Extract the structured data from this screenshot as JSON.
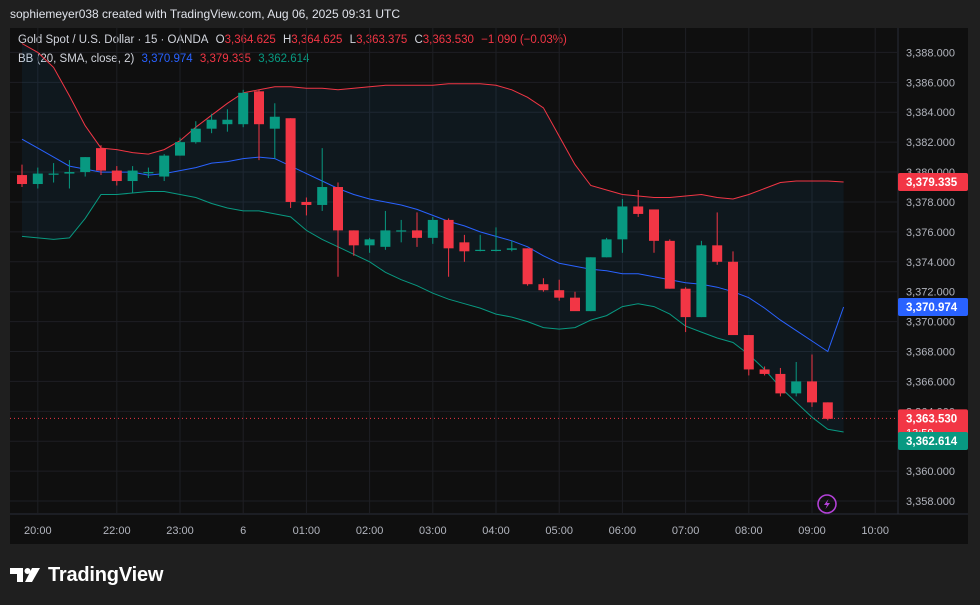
{
  "watermark": {
    "text": "sophiemeyer038 created with TradingView.com, Aug 06, 2025 09:31 UTC"
  },
  "legend": {
    "symbol": "Gold Spot / U.S. Dollar · 15 · OANDA",
    "o_label": "O",
    "o_value": "3,364.625",
    "h_label": "H",
    "h_value": "3,364.625",
    "l_label": "L",
    "l_value": "3,363.375",
    "c_label": "C",
    "c_value": "3,363.530",
    "change": "−1.090 (−0.03%)",
    "bb_label": "BB (20, SMA, close, 2)",
    "bb_basis": "3,370.974",
    "bb_upper": "3,379.335",
    "bb_lower": "3,362.614"
  },
  "price_tags": {
    "upper": "3,379.335",
    "basis": "3,370.974",
    "last_price": "3,363.530",
    "countdown": "13:59",
    "lower": "3,362.614"
  },
  "footer": {
    "brand": "TradingView"
  },
  "colors": {
    "up": "#089981",
    "down": "#f23645",
    "basis": "#2962ff",
    "upper_band": "#f23645",
    "lower_band": "#089981"
  },
  "chart_data": {
    "type": "candlestick",
    "y_range": [
      3357,
      3389.5
    ],
    "y_ticks": [
      "3,358.000",
      "3,360.000",
      "3,362.000",
      "3,364.000",
      "3,366.000",
      "3,368.000",
      "3,370.000",
      "3,372.000",
      "3,374.000",
      "3,376.000",
      "3,378.000",
      "3,380.000",
      "3,382.000",
      "3,384.000",
      "3,386.000",
      "3,388.000"
    ],
    "y_tick_values": [
      3358,
      3360,
      3362,
      3364,
      3366,
      3368,
      3370,
      3372,
      3374,
      3376,
      3378,
      3380,
      3382,
      3384,
      3386,
      3388
    ],
    "x_labels": [
      "20:00",
      "22:00",
      "23:00",
      "6",
      "01:00",
      "02:00",
      "03:00",
      "04:00",
      "05:00",
      "06:00",
      "07:00",
      "08:00",
      "09:00",
      "10:00"
    ],
    "x_label_index": [
      1,
      6,
      10,
      14,
      18,
      22,
      26,
      30,
      34,
      38,
      42,
      46,
      50,
      54
    ],
    "candles": [
      {
        "o": 3379.8,
        "h": 3380.5,
        "l": 3379.0,
        "c": 3379.2
      },
      {
        "o": 3379.2,
        "h": 3380.3,
        "l": 3378.9,
        "c": 3379.9
      },
      {
        "o": 3379.9,
        "h": 3380.6,
        "l": 3379.3,
        "c": 3379.9
      },
      {
        "o": 3379.9,
        "h": 3380.8,
        "l": 3378.9,
        "c": 3380.0
      },
      {
        "o": 3380.0,
        "h": 3381.0,
        "l": 3379.7,
        "c": 3381.0
      },
      {
        "o": 3381.6,
        "h": 3381.8,
        "l": 3379.8,
        "c": 3380.1
      },
      {
        "o": 3380.1,
        "h": 3380.4,
        "l": 3379.1,
        "c": 3379.4
      },
      {
        "o": 3379.4,
        "h": 3380.4,
        "l": 3378.6,
        "c": 3380.1
      },
      {
        "o": 3380.0,
        "h": 3380.3,
        "l": 3379.6,
        "c": 3380.0
      },
      {
        "o": 3379.7,
        "h": 3381.2,
        "l": 3379.4,
        "c": 3381.1
      },
      {
        "o": 3381.1,
        "h": 3382.3,
        "l": 3381.1,
        "c": 3382.0
      },
      {
        "o": 3382.0,
        "h": 3383.4,
        "l": 3381.9,
        "c": 3382.9
      },
      {
        "o": 3382.9,
        "h": 3383.9,
        "l": 3382.6,
        "c": 3383.5
      },
      {
        "o": 3383.2,
        "h": 3384.2,
        "l": 3382.7,
        "c": 3383.5
      },
      {
        "o": 3383.2,
        "h": 3385.5,
        "l": 3383.0,
        "c": 3385.3
      },
      {
        "o": 3385.4,
        "h": 3385.5,
        "l": 3380.8,
        "c": 3383.2
      },
      {
        "o": 3382.9,
        "h": 3384.6,
        "l": 3380.9,
        "c": 3383.7
      },
      {
        "o": 3383.6,
        "h": 3383.6,
        "l": 3377.6,
        "c": 3378.0
      },
      {
        "o": 3378.0,
        "h": 3378.3,
        "l": 3377.1,
        "c": 3377.8
      },
      {
        "o": 3377.8,
        "h": 3381.6,
        "l": 3377.4,
        "c": 3379.0
      },
      {
        "o": 3379.0,
        "h": 3379.3,
        "l": 3373.0,
        "c": 3376.1
      },
      {
        "o": 3376.1,
        "h": 3376.1,
        "l": 3374.4,
        "c": 3375.1
      },
      {
        "o": 3375.1,
        "h": 3375.6,
        "l": 3374.6,
        "c": 3375.5
      },
      {
        "o": 3375.0,
        "h": 3377.4,
        "l": 3374.8,
        "c": 3376.1
      },
      {
        "o": 3376.1,
        "h": 3376.8,
        "l": 3375.3,
        "c": 3376.1
      },
      {
        "o": 3376.1,
        "h": 3377.3,
        "l": 3375.0,
        "c": 3375.6
      },
      {
        "o": 3375.6,
        "h": 3377.0,
        "l": 3375.2,
        "c": 3376.8
      },
      {
        "o": 3376.8,
        "h": 3376.9,
        "l": 3373.0,
        "c": 3374.9
      },
      {
        "o": 3375.3,
        "h": 3375.8,
        "l": 3374.0,
        "c": 3374.7
      },
      {
        "o": 3374.8,
        "h": 3375.8,
        "l": 3374.7,
        "c": 3374.8
      },
      {
        "o": 3374.8,
        "h": 3376.3,
        "l": 3374.7,
        "c": 3374.8
      },
      {
        "o": 3374.8,
        "h": 3375.4,
        "l": 3374.7,
        "c": 3374.9
      },
      {
        "o": 3374.9,
        "h": 3374.9,
        "l": 3372.4,
        "c": 3372.5
      },
      {
        "o": 3372.5,
        "h": 3372.9,
        "l": 3372.0,
        "c": 3372.1
      },
      {
        "o": 3372.1,
        "h": 3372.8,
        "l": 3371.4,
        "c": 3371.6
      },
      {
        "o": 3371.6,
        "h": 3372.0,
        "l": 3370.8,
        "c": 3370.7
      },
      {
        "o": 3370.7,
        "h": 3374.3,
        "l": 3370.7,
        "c": 3374.3
      },
      {
        "o": 3374.3,
        "h": 3375.6,
        "l": 3374.3,
        "c": 3375.5
      },
      {
        "o": 3375.5,
        "h": 3378.2,
        "l": 3374.6,
        "c": 3377.7
      },
      {
        "o": 3377.7,
        "h": 3378.8,
        "l": 3377.0,
        "c": 3377.2
      },
      {
        "o": 3377.5,
        "h": 3377.5,
        "l": 3374.6,
        "c": 3375.4
      },
      {
        "o": 3375.4,
        "h": 3375.5,
        "l": 3372.2,
        "c": 3372.2
      },
      {
        "o": 3372.2,
        "h": 3372.3,
        "l": 3369.3,
        "c": 3370.3
      },
      {
        "o": 3370.3,
        "h": 3375.4,
        "l": 3370.3,
        "c": 3375.1
      },
      {
        "o": 3375.1,
        "h": 3377.3,
        "l": 3373.8,
        "c": 3374.0
      },
      {
        "o": 3374.0,
        "h": 3374.7,
        "l": 3369.1,
        "c": 3369.1
      },
      {
        "o": 3369.1,
        "h": 3369.1,
        "l": 3366.4,
        "c": 3366.8
      },
      {
        "o": 3366.8,
        "h": 3367.0,
        "l": 3366.4,
        "c": 3366.5
      },
      {
        "o": 3366.5,
        "h": 3366.9,
        "l": 3365.0,
        "c": 3365.2
      },
      {
        "o": 3365.2,
        "h": 3367.3,
        "l": 3365.0,
        "c": 3366.0
      },
      {
        "o": 3366.0,
        "h": 3367.8,
        "l": 3364.3,
        "c": 3364.6
      },
      {
        "o": 3364.6,
        "h": 3364.6,
        "l": 3363.4,
        "c": 3363.5
      }
    ],
    "bb_basis": [
      3382.2,
      3381.6,
      3381.0,
      3380.4,
      3380.2,
      3380.0,
      3380.0,
      3380.0,
      3379.8,
      3379.9,
      3380.1,
      3380.3,
      3380.6,
      3380.7,
      3380.9,
      3381.0,
      3380.9,
      3380.4,
      3379.9,
      3379.4,
      3378.9,
      3378.5,
      3378.2,
      3378.0,
      3377.8,
      3377.5,
      3377.1,
      3376.7,
      3376.4,
      3376.0,
      3375.7,
      3375.4,
      3375.0,
      3374.4,
      3373.9,
      3373.7,
      3373.5,
      3373.4,
      3373.2,
      3373.2,
      3373.0,
      3372.8,
      3372.6,
      3372.5,
      3372.3,
      3372.0,
      3371.6,
      3370.9,
      3370.1,
      3369.4,
      3368.7,
      3368.0,
      3370.974
    ],
    "bb_upper": [
      3388.6,
      3388.0,
      3387.0,
      3385.1,
      3383.1,
      3381.6,
      3381.5,
      3381.3,
      3381.2,
      3381.5,
      3382.1,
      3383.0,
      3383.8,
      3384.6,
      3385.3,
      3385.5,
      3385.7,
      3385.7,
      3385.6,
      3385.6,
      3385.5,
      3385.6,
      3385.7,
      3385.8,
      3385.8,
      3385.8,
      3385.8,
      3385.9,
      3385.9,
      3385.9,
      3385.8,
      3385.5,
      3385.0,
      3384.3,
      3382.4,
      3380.5,
      3379.1,
      3378.8,
      3378.5,
      3378.4,
      3378.3,
      3378.3,
      3378.4,
      3378.5,
      3378.3,
      3378.2,
      3378.5,
      3378.9,
      3379.3,
      3379.4,
      3379.4,
      3379.4,
      3379.335
    ],
    "bb_lower": [
      3375.7,
      3375.6,
      3375.5,
      3375.6,
      3376.9,
      3378.5,
      3378.5,
      3378.6,
      3378.7,
      3378.7,
      3378.5,
      3378.3,
      3377.9,
      3377.6,
      3377.4,
      3377.4,
      3377.2,
      3377.0,
      3376.1,
      3375.5,
      3375.0,
      3374.5,
      3374.0,
      3373.3,
      3372.8,
      3372.4,
      3371.9,
      3371.5,
      3371.2,
      3370.9,
      3370.5,
      3370.3,
      3370.0,
      3369.6,
      3369.5,
      3369.6,
      3370.1,
      3370.4,
      3371.0,
      3371.2,
      3371.0,
      3370.5,
      3369.7,
      3369.3,
      3368.9,
      3368.6,
      3367.8,
      3366.8,
      3365.6,
      3364.6,
      3363.6,
      3362.8,
      3362.614
    ]
  }
}
